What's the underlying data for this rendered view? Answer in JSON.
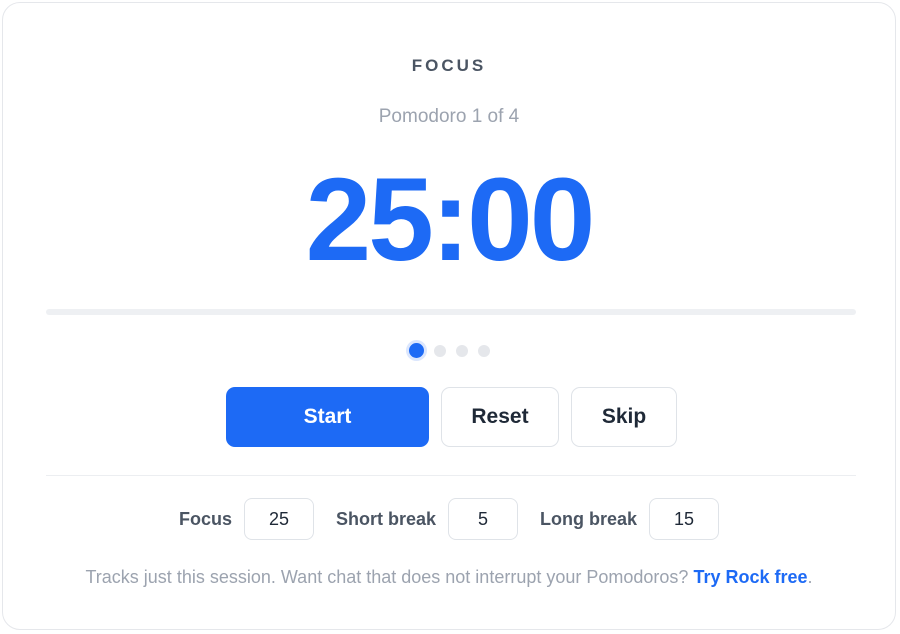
{
  "timer": {
    "mode_label": "FOCUS",
    "session_text": "Pomodoro 1 of 4",
    "time_display": "25:00",
    "progress_fraction": 0,
    "session_dots": {
      "total": 4,
      "current": 1
    }
  },
  "controls": {
    "start_label": "Start",
    "reset_label": "Reset",
    "skip_label": "Skip"
  },
  "settings": {
    "focus": {
      "label": "Focus",
      "value": "25"
    },
    "short_break": {
      "label": "Short break",
      "value": "5"
    },
    "long_break": {
      "label": "Long break",
      "value": "15"
    }
  },
  "footer": {
    "text": "Tracks just this session. Want chat that does not interrupt your Pomodoros?",
    "link_text": "Try Rock free",
    "trailing": "."
  },
  "colors": {
    "accent": "#1d6af5",
    "muted_text": "#9ca3af",
    "border": "#dfe3e8"
  }
}
